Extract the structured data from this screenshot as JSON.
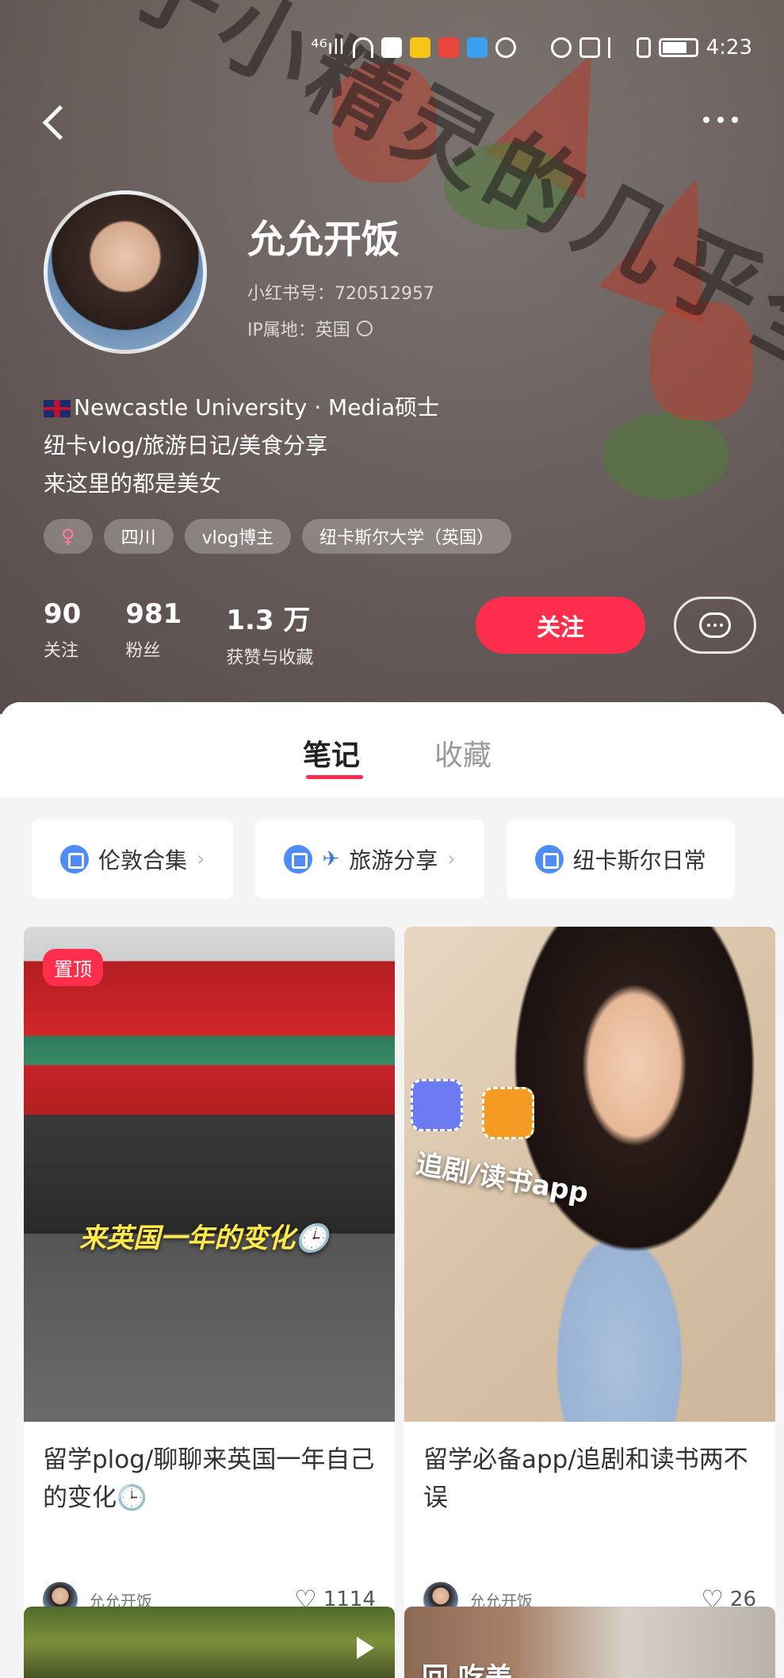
{
  "status_bar": {
    "network": "⁴⁶ıll",
    "time": "4:23"
  },
  "profile": {
    "nickname": "允允开饭",
    "redbook_id": "小红书号：720512957",
    "ip_location": "IP属地：英国",
    "bio_lines": [
      "Newcastle University · Media硕士",
      "纽卡vlog/旅游日记/美食分享",
      "来这里的都是美女"
    ],
    "tags": [
      "♀",
      "四川",
      "vlog博主",
      "纽卡斯尔大学（英国）"
    ],
    "stats": [
      {
        "num": "90",
        "label": "关注"
      },
      {
        "num": "981",
        "label": "粉丝"
      },
      {
        "num": "1.3 万",
        "label": "获赞与收藏"
      }
    ],
    "follow_label": "关注"
  },
  "tabs": {
    "notes": "笔记",
    "collections": "收藏"
  },
  "collections": [
    {
      "label": "伦敦合集",
      "prefix": ""
    },
    {
      "label": "旅游分享",
      "prefix": "✈"
    },
    {
      "label": "纽卡斯尔日常",
      "prefix": ""
    }
  ],
  "notes": [
    {
      "badge": "置顶",
      "image_caption": "来英国一年的变化🕒",
      "title": "留学plog/聊聊来英国一年自己的变化🕒",
      "author": "允允开饭",
      "likes": "1114"
    },
    {
      "image_caption": "追剧/读书app",
      "title": "留学必备app/追剧和读书两不误",
      "author": "允允开饭",
      "likes": "26"
    },
    {
      "image_caption": ""
    },
    {
      "image_caption": "回 吃美"
    }
  ],
  "colors": {
    "accent": "#ff2e4d",
    "collection_icon": "#4e8cf7"
  }
}
